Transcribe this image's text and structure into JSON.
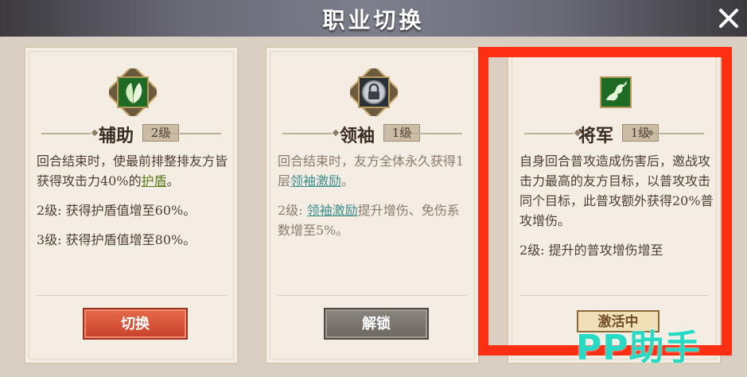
{
  "header": {
    "title": "职业切换"
  },
  "panels": [
    {
      "name": "辅助",
      "level": "2级",
      "icon": "leaves-icon",
      "desc": [
        "回合结束时，使最前排整排友方皆获得攻击力40%的",
        "护盾",
        "。"
      ],
      "lines": [
        "2级: 获得护盾值增至60%。",
        "3级: 获得护盾值增至80%。"
      ],
      "button": "切换"
    },
    {
      "name": "领袖",
      "level": "1级",
      "icon": "lock-icon",
      "desc": [
        "回合结束时，友方全体永久获得1层",
        "领袖激励",
        "。"
      ],
      "lines": [
        "2级: ",
        "领袖激励",
        "提升增伤、免伤系数增至5%。"
      ],
      "button": "解锁"
    },
    {
      "name": "将军",
      "level": "1级",
      "icon": "dragon-icon",
      "desc": [
        "自身回合普攻造成伤害后，邀战攻击力最高的友方目标，以普攻攻击同个目标，此普攻额外获得20%普攻增伤。"
      ],
      "lines": [
        "2级: 提升的普攻增伤增至"
      ],
      "button": "激活中"
    }
  ],
  "watermark": "PP助手",
  "colors": {
    "highlight": "#ff2f13",
    "switch": "#d9533a",
    "unlock": "#7a746e",
    "green_kw": "#5f7a1e",
    "teal_kw": "#3f8e8c"
  }
}
